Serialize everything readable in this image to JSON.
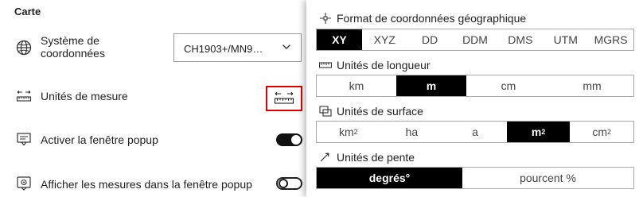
{
  "left_panel": {
    "title": "Carte",
    "crs": {
      "label": "Système de coordonnées",
      "value": "CH1903+/MN9…"
    },
    "units": {
      "label": "Unités de mesure"
    },
    "popup": {
      "label": "Activer la fenêtre popup",
      "enabled": true
    },
    "measures_popup": {
      "label": "Afficher les mesures dans la fenêtre popup",
      "enabled": false
    }
  },
  "popover": {
    "coord_format": {
      "title": "Format de coordonnées géographique",
      "options": [
        "XY",
        "XYZ",
        "DD",
        "DDM",
        "DMS",
        "UTM",
        "MGRS"
      ],
      "selected": "XY"
    },
    "length_units": {
      "title": "Unités de longueur",
      "options": [
        "km",
        "m",
        "cm",
        "mm"
      ],
      "selected": "m"
    },
    "area_units": {
      "title": "Unités de surface",
      "options": [
        "km",
        "ha",
        "a",
        "m",
        "cm"
      ],
      "superscripts": [
        "2",
        "",
        "",
        "2",
        "2"
      ],
      "selected_index": 3
    },
    "slope_units": {
      "title": "Unités de pente",
      "options": [
        "degrés°",
        "pourcent %"
      ],
      "selected": "degrés°"
    }
  },
  "colors": {
    "highlight_border": "#e00000",
    "selected_bg": "#000000"
  }
}
